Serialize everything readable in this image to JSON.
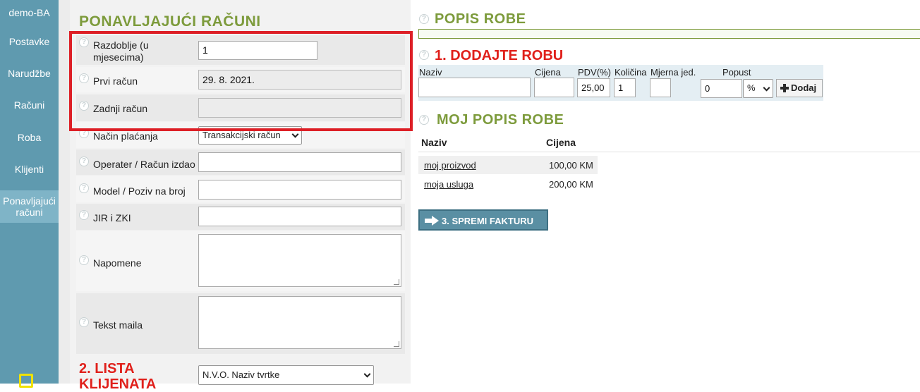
{
  "sidebar": {
    "items": [
      {
        "label": "demo-BA"
      },
      {
        "label": "Postavke"
      },
      {
        "label": "Narudžbe"
      },
      {
        "label": "Računi"
      },
      {
        "label": "Roba"
      },
      {
        "label": "Klijenti"
      },
      {
        "label_line1": "Ponavljajući",
        "label_line2": "računi"
      }
    ],
    "bottom_icon": "exit-icon"
  },
  "form": {
    "title": "PONAVLJAJUĆI RAČUNI",
    "help_glyph": "?",
    "fields": {
      "period": {
        "label_line1": "Razdoblje (u",
        "label_line2": "mjesecima)",
        "value": "1"
      },
      "first_invoice": {
        "label": "Prvi račun",
        "value": "29. 8. 2021."
      },
      "last_invoice": {
        "label": "Zadnji račun",
        "value": ""
      },
      "payment_method": {
        "label": "Način plaćanja",
        "value": "Transakcijski račun"
      },
      "operator": {
        "label": "Operater / Račun izdao",
        "value": ""
      },
      "model_reference": {
        "label": "Model / Poziv na broj",
        "value": ""
      },
      "jir_zki": {
        "label": "JIR i ZKI",
        "value": ""
      },
      "notes": {
        "label": "Napomene",
        "value": ""
      },
      "email_text": {
        "label": "Tekst maila",
        "value": ""
      }
    },
    "client_list": {
      "title_line1": "2. LISTA",
      "title_line2": "KLIJENATA",
      "select_value": "N.V.O. Naziv tvrtke"
    }
  },
  "goods": {
    "title": "POPIS ROBE",
    "add_title": "1. DODAJTE ROBU",
    "columns": {
      "name": "Naziv",
      "price": "Cijena",
      "vat": "PDV(%)",
      "qty": "Količina",
      "unit": "Mjerna jed.",
      "discount": "Popust"
    },
    "values": {
      "name": "",
      "price": "",
      "vat": "25,00",
      "qty": "1",
      "unit": "",
      "discount": "0",
      "discount_type": "%"
    },
    "add_button": "Dodaj",
    "my_list": {
      "title": "MOJ POPIS ROBE",
      "headers": [
        "Naziv",
        "Cijena"
      ],
      "rows": [
        {
          "name": "moj proizvod",
          "price": "100,00 KM"
        },
        {
          "name": "moja usluga",
          "price": "200,00 KM"
        }
      ]
    },
    "save_button": "3. SPREMI FAKTURU"
  },
  "colors": {
    "sidebar": "#5f9aaf",
    "heading_green": "#7d9b3c",
    "heading_red": "#e0201b",
    "highlight_box": "#dd1f26",
    "save_button": "#5a8fa3"
  }
}
